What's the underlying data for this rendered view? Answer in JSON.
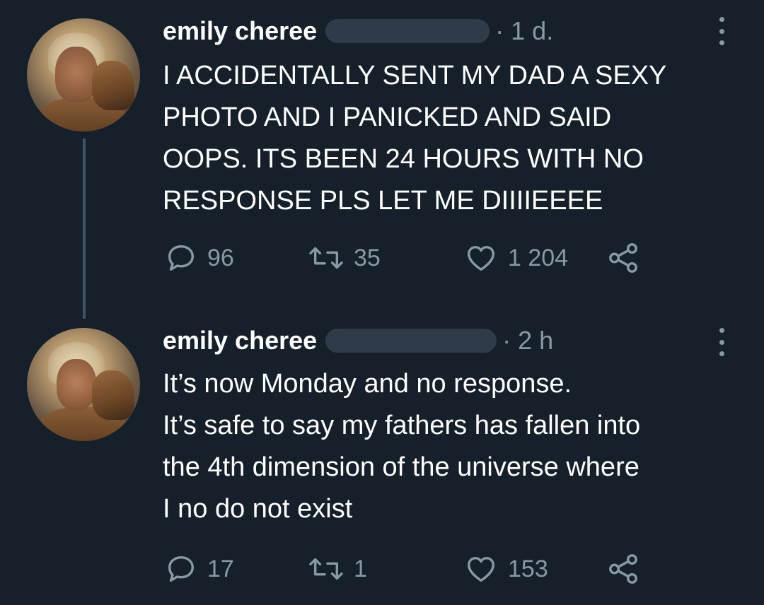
{
  "tweets": [
    {
      "author": "emily cheree",
      "time": "· 1 d.",
      "text": "I ACCIDENTALLY SENT MY DAD A SEXY\nPHOTO AND I PANICKED AND SAID\nOOPS. ITS BEEN 24 HOURS WITH NO\nRESPONSE PLS LET ME DIIIIEEEE",
      "replies": "96",
      "retweets": "35",
      "likes": "1 204"
    },
    {
      "author": "emily cheree",
      "time": "· 2 h",
      "text": "It’s now Monday and no response.\nIt’s safe to say my fathers has fallen into\nthe 4th dimension of the universe where\nI no do not exist",
      "replies": "17",
      "retweets": "1",
      "likes": "153"
    }
  ],
  "icons": {
    "reply": "reply-icon",
    "retweet": "retweet-icon",
    "like": "heart-icon",
    "share": "share-icon",
    "more": "more-icon"
  },
  "colors": {
    "background": "#15202b",
    "text": "#ffffff",
    "secondary": "#8899a6",
    "thread_line": "#3d5466"
  }
}
